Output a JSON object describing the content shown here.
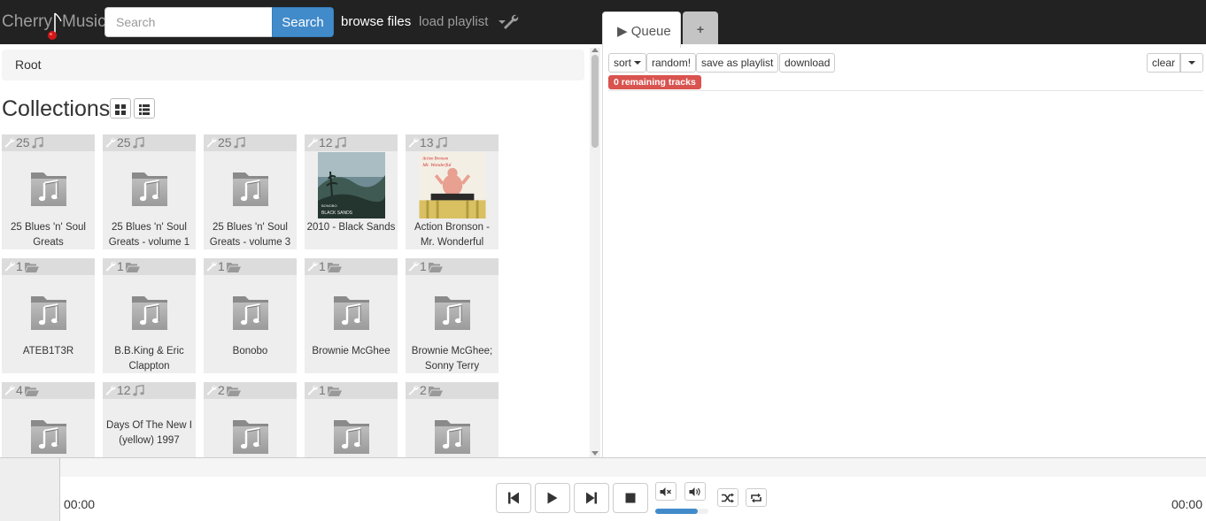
{
  "navbar": {
    "brand_left": "Cherry",
    "brand_right": "Music",
    "search_placeholder": "Search",
    "search_button": "Search",
    "browse_files": "browse files",
    "load_playlist": "load playlist",
    "admin_icon": "wrench-icon"
  },
  "queue_tabs": {
    "queue_label": "▶ Queue",
    "add_tab": "+"
  },
  "browser": {
    "breadcrumb": "Root",
    "title": "Collections",
    "tiles": [
      {
        "count": "25",
        "kind": "music-icon",
        "label": "25 Blues 'n' Soul Greats",
        "cover": "folder"
      },
      {
        "count": "25",
        "kind": "music-icon",
        "label": "25 Blues 'n' Soul Greats - volume 1",
        "cover": "folder"
      },
      {
        "count": "25",
        "kind": "music-icon",
        "label": "25 Blues 'n' Soul Greats - volume 3",
        "cover": "folder"
      },
      {
        "count": "12",
        "kind": "music-icon",
        "label": "2010 - Black Sands",
        "cover": "bonobo-album-art"
      },
      {
        "count": "13",
        "kind": "music-icon",
        "label": "Action Bronson - Mr. Wonderful",
        "cover": "mr-wonderful-album-art"
      },
      {
        "count": "1",
        "kind": "folder-icon",
        "label": "ATEB1T3R",
        "cover": "folder"
      },
      {
        "count": "1",
        "kind": "folder-icon",
        "label": "B.B.King & Eric Clappton",
        "cover": "folder"
      },
      {
        "count": "1",
        "kind": "folder-icon",
        "label": "Bonobo",
        "cover": "folder"
      },
      {
        "count": "1",
        "kind": "folder-icon",
        "label": "Brownie McGhee",
        "cover": "folder"
      },
      {
        "count": "1",
        "kind": "folder-icon",
        "label": "Brownie McGhee; Sonny Terry",
        "cover": "folder"
      },
      {
        "count": "4",
        "kind": "folder-icon",
        "label": "",
        "cover": "folder"
      },
      {
        "count": "12",
        "kind": "music-icon",
        "label": "Days Of The New I (yellow) 1997",
        "cover": "none"
      },
      {
        "count": "2",
        "kind": "folder-icon",
        "label": "",
        "cover": "folder"
      },
      {
        "count": "1",
        "kind": "folder-icon",
        "label": "",
        "cover": "folder"
      },
      {
        "count": "2",
        "kind": "folder-icon",
        "label": "",
        "cover": "folder"
      }
    ]
  },
  "playlist": {
    "sort": "sort",
    "random": "random!",
    "save_as_playlist": "save as playlist",
    "download": "download",
    "clear": "clear",
    "remaining": "0 remaining tracks"
  },
  "player": {
    "time_elapsed": "00:00",
    "time_total": "00:00",
    "volume_level": 0.8
  },
  "colors": {
    "navbar_bg": "#222222",
    "accent": "#428bca",
    "badge": "#d9534f"
  }
}
